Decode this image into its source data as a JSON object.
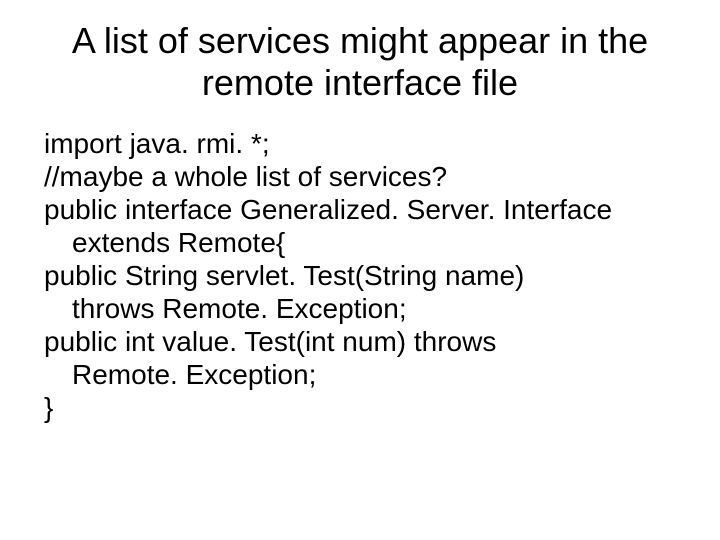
{
  "title": "A list of services might appear in the remote interface file",
  "code": {
    "l1": "import java. rmi. *;",
    "l2": "//maybe a whole list of services?",
    "l3": "public interface Generalized. Server. Interface",
    "l3b": "extends Remote{",
    "l4": "public String servlet. Test(String name)",
    "l4b": "throws Remote. Exception;",
    "l5": "public int value. Test(int num) throws",
    "l5b": "Remote. Exception;",
    "l6": "}"
  }
}
